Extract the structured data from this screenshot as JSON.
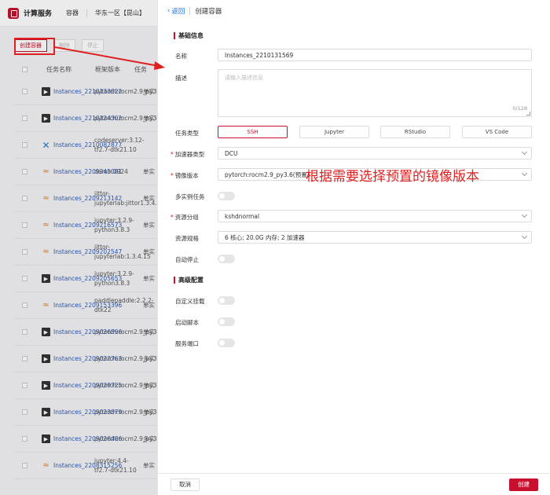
{
  "app": {
    "name": "计算服务",
    "nav_item": "容器",
    "region": "华东一区【昆山】"
  },
  "toolbar": {
    "create_label": "创建容器",
    "delete_label": "删除",
    "stop_label": "停止"
  },
  "table": {
    "headers": {
      "name": "任务名称",
      "image": "框架版本",
      "type": "任务"
    },
    "rows": [
      {
        "icon": "terminal-icon",
        "name": "Instances_2210133622",
        "image": "pytorch:rocm2.9_py3.6",
        "type": "单实"
      },
      {
        "icon": "terminal-icon",
        "name": "Instances_2210124302",
        "image": "pytorch:rocm2.9_py3.6",
        "type": "单实"
      },
      {
        "icon": "vscode-icon",
        "name": "Instances_2210082877",
        "image": "codeserver:3.12-tf2.7-dtk21.10",
        "type": ""
      },
      {
        "icon": "jupyter-icon",
        "name": "Instances_2209245081",
        "image": "demo:0924",
        "type": "单实"
      },
      {
        "icon": "jupyter-icon",
        "name": "Instances_2209213142",
        "image": "jittor-jupyterlab:jittor1.3.4.15",
        "type": "单实"
      },
      {
        "icon": "jupyter-icon",
        "name": "Instances_2209216573",
        "image": "jupyter:3.2.9-python3.8.3",
        "type": "单实"
      },
      {
        "icon": "jupyter-icon",
        "name": "Instances_2209202547",
        "image": "jittor-jupyterlab:1.3.4.15",
        "type": "单实"
      },
      {
        "icon": "terminal-icon",
        "name": "Instances_2209205653",
        "image": "jupyter:3.2.9-python3.8.3",
        "type": "单实"
      },
      {
        "icon": "jupyter-icon",
        "name": "Instances_2209153396",
        "image": "paddlepaddle:2.2.2-dtk22",
        "type": "单实"
      },
      {
        "icon": "terminal-icon",
        "name": "Instances_2209026896",
        "image": "pytorch:rocm2.9_py3.6",
        "type": "单实"
      },
      {
        "icon": "terminal-icon",
        "name": "Instances_2209022763",
        "image": "pytorch:rocm2.9_py3.6",
        "type": "多实"
      },
      {
        "icon": "terminal-icon",
        "name": "Instances_2209029725",
        "image": "pytorch:rocm2.9_py3.6",
        "type": "单实"
      },
      {
        "icon": "terminal-icon",
        "name": "Instances_2209023879",
        "image": "pytorch:rocm2.9_py3.6",
        "type": "单实"
      },
      {
        "icon": "terminal-icon",
        "name": "Instances_2209026486",
        "image": "pytorch:rocm2.9_py3.6",
        "type": "多实"
      },
      {
        "icon": "jupyter-icon",
        "name": "Instances_2208315256",
        "image": "jupyter:4.4-tf2.7-dtk21.10",
        "type": "单实"
      }
    ]
  },
  "drawer": {
    "back_label": "返回",
    "title": "创建容器",
    "section_basic": "基础信息",
    "name_label": "名称",
    "name_value": "Instances_2210131569",
    "desc_label": "描述",
    "desc_placeholder": "请输入描述信息",
    "desc_count": "0/128",
    "task_type_label": "任务类型",
    "task_types": [
      "SSH",
      "Jupyter",
      "RStudio",
      "VS Code"
    ],
    "accel_type_label": "加速器类型",
    "accel_type_value": "DCU",
    "image_label": "镜像版本",
    "image_value": "pytorch:rocm2.9_py3.6(预置)",
    "multi_instance_label": "多实例任务",
    "resource_group_label": "资源分组",
    "resource_group_value": "kshdnormal",
    "resource_spec_label": "资源规格",
    "resource_spec_value": "6 核心; 20.0G 内存; 2 加速器",
    "auto_stop_label": "自动停止",
    "section_advanced": "高级配置",
    "custom_mount_label": "自定义挂载",
    "startup_script_label": "启动脚本",
    "service_port_label": "服务端口",
    "cancel_label": "取消",
    "create_label": "创建"
  },
  "annotation": {
    "text": "根据需要选择预置的镜像版本",
    "color": "#e02020"
  },
  "colors": {
    "accent": "#c8102e",
    "link": "#2a5bb8"
  }
}
